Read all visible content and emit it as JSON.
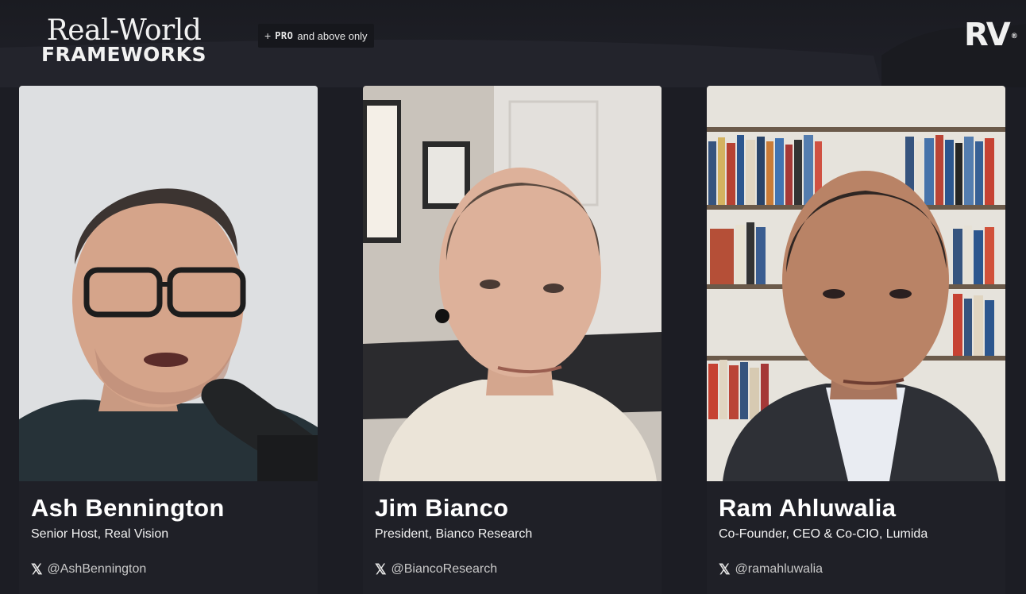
{
  "brand": {
    "title_line1": "Real-World",
    "title_line2": "FRAMEWORKS",
    "rv_logo": "RV",
    "rv_mark": "®"
  },
  "badge": {
    "plus": "+",
    "pro": "PRO",
    "text": "and above only"
  },
  "participants": [
    {
      "name": "Ash Bennington",
      "role": "Senior Host, Real Vision",
      "handle": "@AshBennington",
      "icon": "x-logo-icon"
    },
    {
      "name": "Jim Bianco",
      "role": "President, Bianco Research",
      "handle": "@BiancoResearch",
      "icon": "x-logo-icon"
    },
    {
      "name": "Ram Ahluwalia",
      "role": "Co-Founder, CEO & Co-CIO, Lumida",
      "handle": "@ramahluwalia",
      "icon": "x-logo-icon"
    }
  ],
  "colors": {
    "background": "#1c1d24",
    "card_info": "#1f2027",
    "text_primary": "#ffffff"
  }
}
